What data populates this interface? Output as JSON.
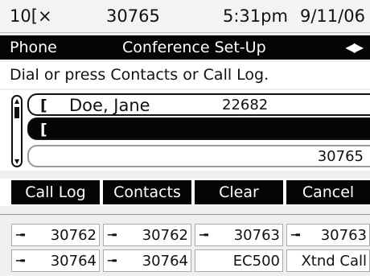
{
  "status": {
    "line_indicator": "1",
    "ext": "30765",
    "time": "5:31pm",
    "date": "9/11/06"
  },
  "title_bar": {
    "app": "Phone",
    "title": "Conference Set-Up",
    "arrows_icon": "left-right-arrows"
  },
  "prompt": "Dial or press Contacts or Call Log.",
  "entries": [
    {
      "name": "Doe, Jane",
      "number": "22682"
    },
    {
      "name": "",
      "number": ""
    },
    {
      "name": "",
      "number": "30765"
    }
  ],
  "softkeys": [
    "Call Log",
    "Contacts",
    "Clear",
    "Cancel"
  ],
  "line_keys": [
    {
      "label": "30762",
      "icon": "handset"
    },
    {
      "label": "30762",
      "icon": "handset"
    },
    {
      "label": "30763",
      "icon": "handset"
    },
    {
      "label": "30763",
      "icon": "handset"
    },
    {
      "label": "30764",
      "icon": "handset"
    },
    {
      "label": "30764",
      "icon": "handset"
    },
    {
      "label": "EC500",
      "icon": ""
    },
    {
      "label": "Xtnd Call",
      "icon": ""
    }
  ]
}
